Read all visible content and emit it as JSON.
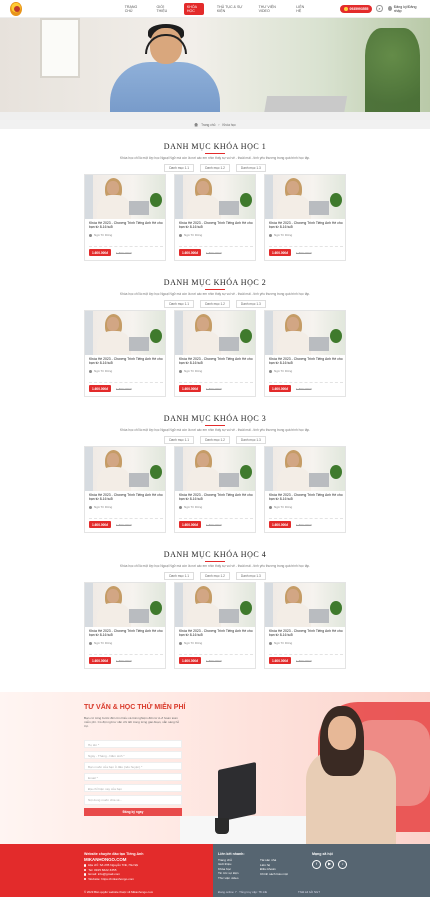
{
  "header": {
    "nav": [
      "Trang chủ",
      "Giới thiệu",
      "Khóa học",
      "Thủ tục & Sự kiện",
      "Thư viện video",
      "Liên hệ"
    ],
    "active_index": 2,
    "hotline": "0935993555",
    "login": "Đăng ký/Đăng nhập"
  },
  "breadcrumb": {
    "home": "Trang chủ",
    "current": "Khóa học"
  },
  "sections": [
    {
      "title": "Danh mục khóa học 1",
      "desc": "Khóa học chỉ là một lớp học Ngoại Ngữ mà còn là nơi các em nhìn thấy sự vui vẻ - thoải mái - tính yêu thương trong quá trình học tập.",
      "tabs": [
        "Danh mục 1.1",
        "Danh mục 1.2",
        "Danh mục 1.3"
      ],
      "cards": [
        {
          "title": "Khóa Hè 2023 - Chương Trình Tiếng Anh Hè cho bạn từ 8-16 tuổi",
          "author": "Ngô Tri Dũng",
          "price": "1.600.000đ",
          "old_price": "1.800.000đ"
        },
        {
          "title": "Khóa Hè 2023 - Chương Trình Tiếng Anh Hè cho bạn từ 8-16 tuổi",
          "author": "Ngô Tri Dũng",
          "price": "1.600.000đ",
          "old_price": "1.800.000đ"
        },
        {
          "title": "Khóa Hè 2023 - Chương Trình Tiếng Anh Hè cho bạn từ 8-16 tuổi",
          "author": "Ngô Tri Dũng",
          "price": "1.600.000đ",
          "old_price": "1.800.000đ"
        }
      ]
    },
    {
      "title": "Danh mục khóa học 2",
      "desc": "Khóa học chỉ là một lớp học Ngoại Ngữ mà còn là nơi các em nhìn thấy sự vui vẻ - thoải mái - tính yêu thương trong quá trình học tập.",
      "tabs": [
        "Danh mục 1.1",
        "Danh mục 1.2",
        "Danh mục 1.3"
      ],
      "cards": [
        {
          "title": "Khóa Hè 2023 - Chương Trình Tiếng Anh Hè cho bạn từ 8-16 tuổi",
          "author": "Ngô Tri Dũng",
          "price": "1.600.000đ",
          "old_price": "1.800.000đ"
        },
        {
          "title": "Khóa Hè 2023 - Chương Trình Tiếng Anh Hè cho bạn từ 8-16 tuổi",
          "author": "Ngô Tri Dũng",
          "price": "1.600.000đ",
          "old_price": "1.800.000đ"
        },
        {
          "title": "Khóa Hè 2023 - Chương Trình Tiếng Anh Hè cho bạn từ 8-16 tuổi",
          "author": "Ngô Tri Dũng",
          "price": "1.600.000đ",
          "old_price": "1.800.000đ"
        }
      ]
    },
    {
      "title": "Danh mục khóa học 3",
      "desc": "Khóa học chỉ là một lớp học Ngoại Ngữ mà còn là nơi các em nhìn thấy sự vui vẻ - thoải mái - tính yêu thương trong quá trình học tập.",
      "tabs": [
        "Danh mục 1.1",
        "Danh mục 1.2",
        "Danh mục 1.3"
      ],
      "cards": [
        {
          "title": "Khóa Hè 2023 - Chương Trình Tiếng Anh Hè cho bạn từ 8-16 tuổi",
          "author": "Ngô Tri Dũng",
          "price": "1.600.000đ",
          "old_price": "1.800.000đ"
        },
        {
          "title": "Khóa Hè 2023 - Chương Trình Tiếng Anh Hè cho bạn từ 8-16 tuổi",
          "author": "Ngô Tri Dũng",
          "price": "1.600.000đ",
          "old_price": "1.800.000đ"
        },
        {
          "title": "Khóa Hè 2023 - Chương Trình Tiếng Anh Hè cho bạn từ 8-16 tuổi",
          "author": "Ngô Tri Dũng",
          "price": "1.600.000đ",
          "old_price": "1.800.000đ"
        }
      ]
    },
    {
      "title": "Danh mục khóa học 4",
      "desc": "Khóa học chỉ là một lớp học Ngoại Ngữ mà còn là nơi các em nhìn thấy sự vui vẻ - thoải mái - tính yêu thương trong quá trình học tập.",
      "tabs": [
        "Danh mục 1.1",
        "Danh mục 1.2",
        "Danh mục 1.3"
      ],
      "cards": [
        {
          "title": "Khóa Hè 2023 - Chương Trình Tiếng Anh Hè cho bạn từ 8-16 tuổi",
          "author": "Ngô Tri Dũng",
          "price": "1.600.000đ",
          "old_price": "1.800.000đ"
        },
        {
          "title": "Khóa Hè 2023 - Chương Trình Tiếng Anh Hè cho bạn từ 8-16 tuổi",
          "author": "Ngô Tri Dũng",
          "price": "1.600.000đ",
          "old_price": "1.800.000đ"
        },
        {
          "title": "Khóa Hè 2023 - Chương Trình Tiếng Anh Hè cho bạn từ 8-16 tuổi",
          "author": "Ngô Tri Dũng",
          "price": "1.600.000đ",
          "old_price": "1.800.000đ"
        }
      ]
    }
  ],
  "consult": {
    "title": "Tư vấn & học thử miễn phí",
    "desc": "Bạn cứ từng bước đến tìm hiểu và trải nghiệm đến từ A-Z hoàn toàn miễn phí. Có đội ngũ tư vấn chi tiết trong từng giai đoạn, sẵn sàng hỗ trợ.",
    "fields": [
      "Họ tên *",
      "Ngày - Tháng - Năm sinh *",
      "Bạn muốn của bạn ở đâu (nếu huyện) *",
      "Email *",
      "Địa chỉ hiện nay của bạn",
      "Nội dung muốn chia sẻ..."
    ],
    "submit": "Đăng ký ngay"
  },
  "footer": {
    "brand_line": "Website chuyên đào tạo Tiếng Anh",
    "brand": "MIKANHONGO.COM",
    "contacts": [
      "Địa chỉ: Số 235 Nguyễn Trãi, Hà Nội",
      "Tel: 0915 6622 3355",
      "Email: info@gmail.com",
      "Website: https://mikanhongo.com"
    ],
    "links_title": "Liên kết nhanh:",
    "links_col1": [
      "Trang chủ",
      "Giới thiệu",
      "Khóa học",
      "Tin tức sự kiện",
      "Thư viện video"
    ],
    "links_col2": [
      "Tài sản nhà",
      "Liên hệ",
      "Điều khoản",
      "Chính sách bảo mật"
    ],
    "social_title": "Mạng xã hội",
    "copyright": "© 2023 Bản quyền website thuộc về Mikanhongo.com",
    "online": "Đang online: 7 · Tổng truy cập: 78.14k",
    "designer": "Thiết kế bởi NGT"
  }
}
